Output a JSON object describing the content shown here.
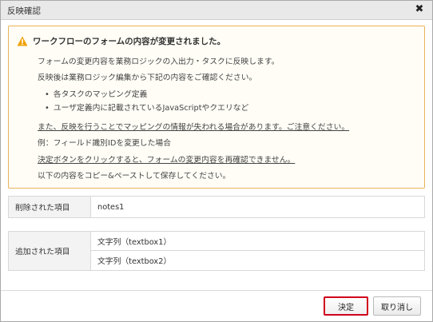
{
  "dialog": {
    "title": "反映確認",
    "close_symbol": "✖"
  },
  "warning": {
    "icon": "warning-triangle-icon",
    "title": "ワークフローのフォームの内容が変更されました。",
    "lines": [
      "フォームの変更内容を業務ロジックの入出力・タスクに反映します。",
      "反映後は業務ロジック編集から下記の内容をご確認ください。"
    ],
    "bullets": [
      "各タスクのマッピング定義",
      "ユーザ定義内に記載されているJavaScriptやクエリなど"
    ],
    "caution": "また、反映を行うことでマッピングの情報が失われる場合があります。ご注意ください。",
    "example": "例：フィールド識別IDを変更した場合",
    "confirm_note": "決定ボタンをクリックすると、フォームの変更内容を再確認できません。",
    "copy_note": "以下の内容をコピー&ペーストして保存してください。"
  },
  "deleted": {
    "label": "削除された項目",
    "items": [
      "notes1"
    ]
  },
  "added": {
    "label": "追加された項目",
    "items": [
      "文字列（textbox1）",
      "文字列（textbox2）"
    ]
  },
  "buttons": {
    "ok": "決定",
    "cancel": "取り消し"
  },
  "colors": {
    "warning_border": "#e8b45a",
    "warning_icon": "#f0a30a",
    "ok_highlight": "#d0021b"
  }
}
